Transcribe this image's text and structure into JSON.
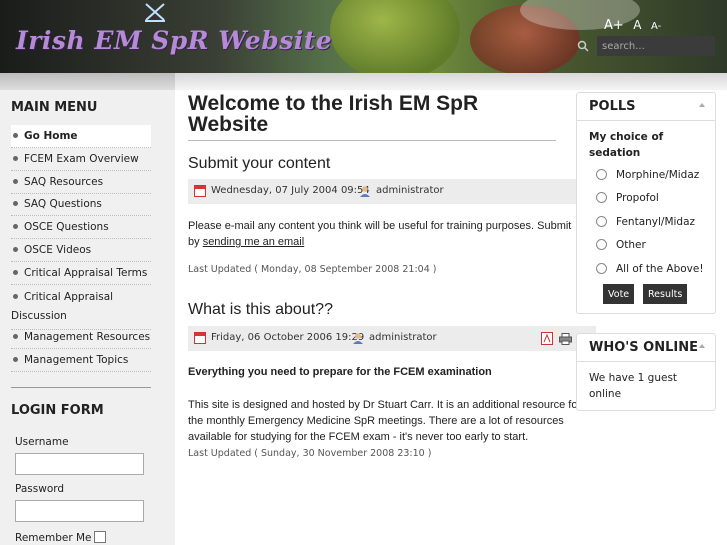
{
  "header": {
    "logo_text": "Irish EM SpR Website",
    "font_controls": [
      "A+",
      "A",
      "A-"
    ],
    "search_placeholder": "search..."
  },
  "sidebar": {
    "main_menu_heading": "MAIN MENU",
    "menu_items": [
      {
        "label": "Go Home",
        "active": true
      },
      {
        "label": "FCEM Exam Overview"
      },
      {
        "label": "SAQ Resources"
      },
      {
        "label": "SAQ Questions"
      },
      {
        "label": "OSCE Questions"
      },
      {
        "label": "OSCE Videos"
      },
      {
        "label": "Critical Appraisal Terms"
      },
      {
        "label": "Critical Appraisal",
        "label_line2": "Discussion"
      },
      {
        "label": "Management Resources"
      },
      {
        "label": "Management Topics"
      }
    ],
    "login_heading": "LOGIN FORM",
    "username_label": "Username",
    "password_label": "Password",
    "remember_label": "Remember Me"
  },
  "main": {
    "page_title": "Welcome to the Irish EM SpR Website",
    "articles": [
      {
        "title": "Submit your content",
        "date": "Wednesday, 07 July 2004 09:54",
        "author": "administrator",
        "body_line1": "Please e-mail any content you think will be useful for training purposes. Submit",
        "body_line2_prefix": "by ",
        "body_link": "sending me an email",
        "updated": "Last Updated ( Monday, 08 September 2008 21:04 )"
      },
      {
        "title": "What is this about??",
        "date": "Friday, 06 October 2006 19:29",
        "author": "administrator",
        "lead": "Everything you need to prepare for the FCEM examination",
        "body_lines": [
          "This site is designed and hosted by Dr Stuart Carr. It is an additional resource for",
          "the monthly Emergency Medicine SpR meetings. There are a lot of resources",
          "available for studying for the FCEM exam - it's never too early to start."
        ],
        "updated": "Last Updated ( Sunday, 30 November 2008 23:10 )"
      }
    ]
  },
  "polls": {
    "heading": "POLLS",
    "question": "My choice of sedation",
    "options": [
      "Morphine/Midaz",
      "Propofol",
      "Fentanyl/Midaz",
      "Other",
      "All of the Above!"
    ],
    "vote_label": "Vote",
    "results_label": "Results"
  },
  "online": {
    "heading": "WHO'S ONLINE",
    "text": "We have 1 guest online"
  },
  "colors": {
    "logo": "#b58ad6",
    "sidebar_bg": "#f0f0f0",
    "button_bg": "#333333"
  }
}
